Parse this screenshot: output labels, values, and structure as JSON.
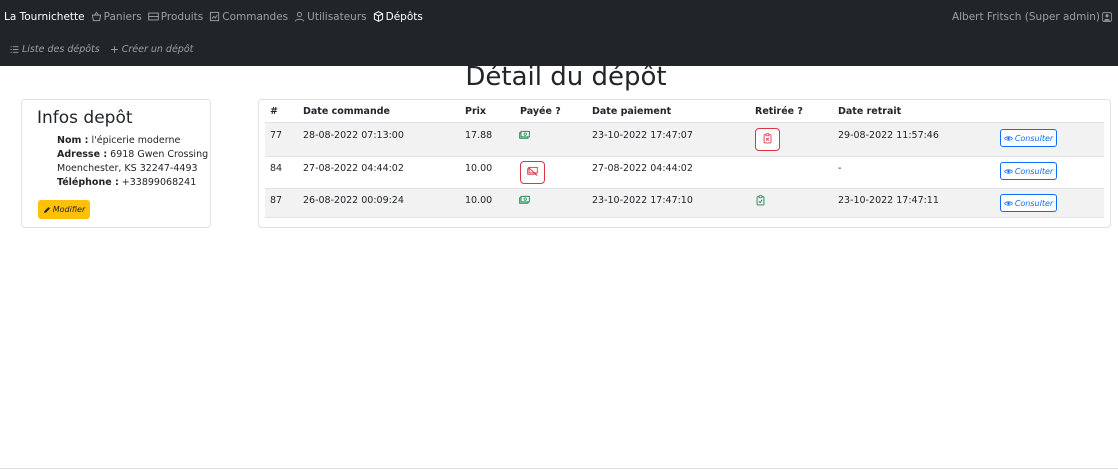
{
  "nav": {
    "brand": "La Tournichette",
    "items": [
      {
        "label": "Paniers",
        "icon": "basket-icon",
        "active": false
      },
      {
        "label": "Produits",
        "icon": "products-icon",
        "active": false
      },
      {
        "label": "Commandes",
        "icon": "orders-icon",
        "active": false
      },
      {
        "label": "Utilisateurs",
        "icon": "user-icon",
        "active": false
      },
      {
        "label": "Dépôts",
        "icon": "box-icon",
        "active": true
      }
    ],
    "user": "Albert Fritsch (Super admin)",
    "user_icon": "user-square-icon"
  },
  "subnav": {
    "list_label": "Liste des dépôts",
    "create_label": "Créer un dépôt"
  },
  "page": {
    "title": "Détail du dépôt"
  },
  "info": {
    "title": "Infos depôt",
    "name_label": "Nom :",
    "name_value": "l'épicerie moderne",
    "address_label": "Adresse :",
    "address_line1": "6918 Gwen Crossing",
    "address_line2": "Moenchester, KS 32247-4493",
    "phone_label": "Téléphone :",
    "phone_value": "+33899068241",
    "edit_label": "Modifier"
  },
  "table": {
    "headers": [
      "#",
      "Date commande",
      "Prix",
      "Payée ?",
      "Date paiement",
      "Retirée ?",
      "Date retrait"
    ],
    "consult_label": "Consulter",
    "rows": [
      {
        "id": "77",
        "date_commande": "28-08-2022 07:13:00",
        "prix": "17.88",
        "payee": true,
        "date_paiement": "23-10-2022 17:47:07",
        "retiree": false,
        "date_retrait": "29-08-2022 11:57:46"
      },
      {
        "id": "84",
        "date_commande": "27-08-2022 04:44:02",
        "prix": "10.00",
        "payee": false,
        "date_paiement": "27-08-2022 04:44:02",
        "retiree": null,
        "date_retrait": "-"
      },
      {
        "id": "87",
        "date_commande": "26-08-2022 00:09:24",
        "prix": "10.00",
        "payee": true,
        "date_paiement": "23-10-2022 17:47:10",
        "retiree": true,
        "date_retrait": "23-10-2022 17:47:11"
      }
    ]
  },
  "colors": {
    "navbar": "#212529",
    "warning": "#ffc107",
    "success": "#198754",
    "danger": "#dc3545",
    "primary": "#0d6efd",
    "stripe": "#f2f2f2"
  }
}
